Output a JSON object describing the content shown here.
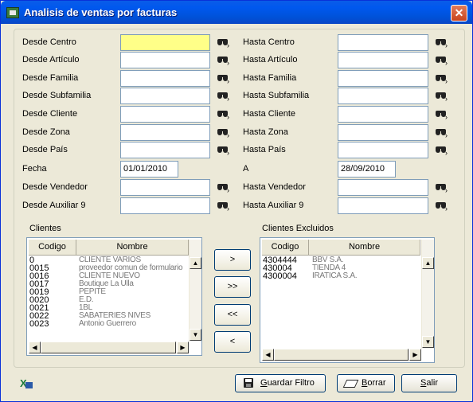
{
  "window": {
    "title": "Analisis de ventas por facturas",
    "close_glyph": "✕"
  },
  "filters": {
    "left": [
      {
        "label": "Desde Centro",
        "value": ""
      },
      {
        "label": "Desde Artículo",
        "value": ""
      },
      {
        "label": "Desde Familia",
        "value": ""
      },
      {
        "label": "Desde Subfamilia",
        "value": ""
      },
      {
        "label": "Desde Cliente",
        "value": ""
      },
      {
        "label": "Desde Zona",
        "value": ""
      },
      {
        "label": "Desde País",
        "value": ""
      }
    ],
    "right": [
      {
        "label": "Hasta Centro",
        "value": ""
      },
      {
        "label": "Hasta Artículo",
        "value": ""
      },
      {
        "label": "Hasta Familia",
        "value": ""
      },
      {
        "label": "Hasta Subfamilia",
        "value": ""
      },
      {
        "label": "Hasta Cliente",
        "value": ""
      },
      {
        "label": "Hasta Zona",
        "value": ""
      },
      {
        "label": "Hasta País",
        "value": ""
      }
    ],
    "fecha": {
      "label": "Fecha",
      "value": "01/01/2010"
    },
    "a": {
      "label": "A",
      "value": "28/09/2010"
    },
    "vendedor": {
      "from_label": "Desde Vendedor",
      "to_label": "Hasta Vendedor"
    },
    "auxiliar": {
      "from_label": "Desde Auxiliar 9",
      "to_label": "Hasta Auxiliar 9"
    }
  },
  "clientes": {
    "label": "Clientes",
    "columns": [
      "Codigo",
      "Nombre"
    ],
    "rows": [
      {
        "code": "0",
        "name": "CLIENTE VARIOS"
      },
      {
        "code": "0015",
        "name": "proveedor comun de formulario"
      },
      {
        "code": "0016",
        "name": "CLIENTE NUEVO"
      },
      {
        "code": "0017",
        "name": "Boutique La Ulla"
      },
      {
        "code": "0019",
        "name": "PEPITE"
      },
      {
        "code": "0020",
        "name": "E.D."
      },
      {
        "code": "0021",
        "name": "1BL"
      },
      {
        "code": "0022",
        "name": "SABATERIES NIVES"
      },
      {
        "code": "0023",
        "name": "Antonio Guerrero"
      }
    ]
  },
  "excluidos": {
    "label": "Clientes Excluidos",
    "columns": [
      "Codigo",
      "Nombre"
    ],
    "rows": [
      {
        "code": "4304444",
        "name": "BBV S.A."
      },
      {
        "code": "430004",
        "name": "TIENDA 4"
      },
      {
        "code": "4300004",
        "name": "IRATICA S.A."
      }
    ]
  },
  "move_buttons": [
    ">",
    ">>",
    "<<",
    "<"
  ],
  "footer": {
    "guardar": {
      "mnemonic": "G",
      "rest": "uardar Filtro"
    },
    "borrar": {
      "mnemonic": "B",
      "rest": "orrar"
    },
    "salir": {
      "mnemonic": "S",
      "rest": "alir"
    }
  },
  "icons": {
    "lookup": "binoculars-icon",
    "app": "app-icon",
    "excel": "excel-export-icon"
  }
}
